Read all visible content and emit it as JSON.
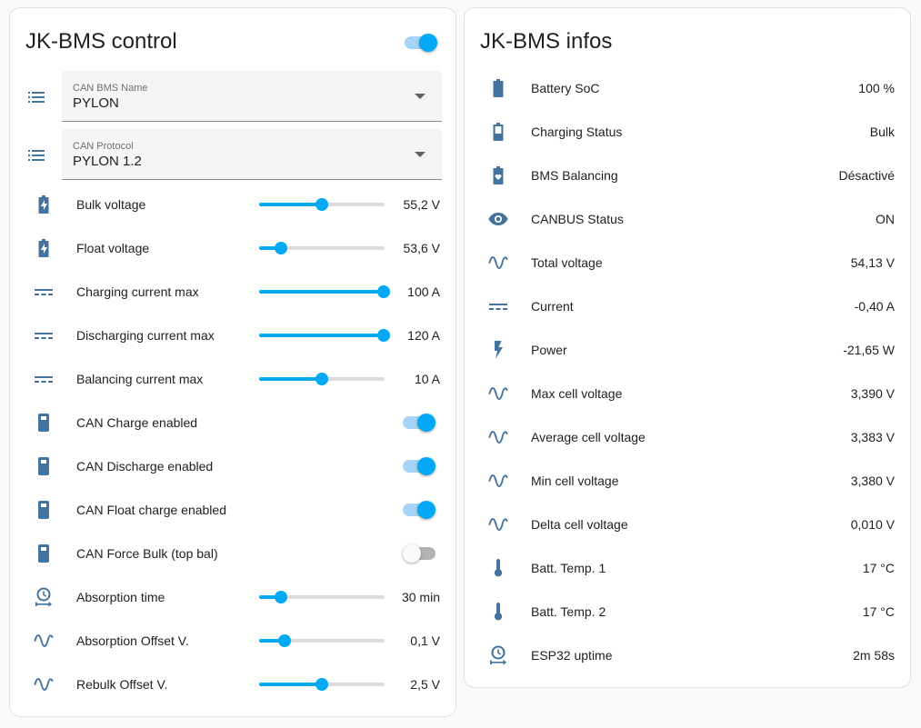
{
  "colors": {
    "accent": "#03a9f4",
    "icon": "#44739e"
  },
  "control": {
    "title": "JK-BMS control",
    "enabled": true,
    "selects": [
      {
        "label": "CAN BMS Name",
        "value": "PYLON",
        "icon": "list-icon"
      },
      {
        "label": "CAN Protocol",
        "value": "PYLON 1.2",
        "icon": "list-icon"
      }
    ],
    "rows": [
      {
        "label": "Bulk voltage",
        "value": "55,2 V",
        "icon": "battery-charging-icon",
        "level": 0.5
      },
      {
        "label": "Float voltage",
        "value": "53,6 V",
        "icon": "battery-charging-icon",
        "level": 0.17
      },
      {
        "label": "Charging current max",
        "value": "100 A",
        "icon": "current-dc-icon",
        "level": 1.0
      },
      {
        "label": "Discharging current max",
        "value": "120 A",
        "icon": "current-dc-icon",
        "level": 1.0
      },
      {
        "label": "Balancing current max",
        "value": "10 A",
        "icon": "current-dc-icon",
        "level": 0.5
      },
      {
        "label": "CAN Charge enabled",
        "on": true,
        "icon": "phone-device-icon"
      },
      {
        "label": "CAN Discharge enabled",
        "on": true,
        "icon": "phone-device-icon"
      },
      {
        "label": "CAN Float charge enabled",
        "on": true,
        "icon": "phone-device-icon"
      },
      {
        "label": "CAN Force Bulk (top bal)",
        "on": false,
        "icon": "phone-device-icon"
      },
      {
        "label": "Absorption time",
        "value": "30 min",
        "icon": "timer-arrow-icon",
        "level": 0.17
      },
      {
        "label": "Absorption Offset V.",
        "value": "0,1 V",
        "icon": "sine-wave-icon",
        "level": 0.2
      },
      {
        "label": "Rebulk Offset V.",
        "value": "2,5 V",
        "icon": "sine-wave-icon",
        "level": 0.5
      }
    ]
  },
  "infos": {
    "title": "JK-BMS infos",
    "rows": [
      {
        "label": "Battery SoC",
        "value": "100 %",
        "icon": "battery-full-icon"
      },
      {
        "label": "Charging Status",
        "value": "Bulk",
        "icon": "battery-icon"
      },
      {
        "label": "BMS Balancing",
        "value": "Désactivé",
        "icon": "battery-heart-icon"
      },
      {
        "label": "CANBUS Status",
        "value": "ON",
        "icon": "eye-icon"
      },
      {
        "label": "Total voltage",
        "value": "54,13 V",
        "icon": "sine-wave-icon"
      },
      {
        "label": "Current",
        "value": "-0,40 A",
        "icon": "current-dc-icon"
      },
      {
        "label": "Power",
        "value": "-21,65 W",
        "icon": "flash-icon"
      },
      {
        "label": "Max cell voltage",
        "value": "3,390 V",
        "icon": "sine-wave-icon"
      },
      {
        "label": "Average cell voltage",
        "value": "3,383 V",
        "icon": "sine-wave-icon"
      },
      {
        "label": "Min cell voltage",
        "value": "3,380 V",
        "icon": "sine-wave-icon"
      },
      {
        "label": "Delta cell voltage",
        "value": "0,010 V",
        "icon": "sine-wave-icon"
      },
      {
        "label": "Batt. Temp. 1",
        "value": "17 °C",
        "icon": "thermometer-icon"
      },
      {
        "label": "Batt. Temp. 2",
        "value": "17 °C",
        "icon": "thermometer-icon"
      },
      {
        "label": "ESP32 uptime",
        "value": "2m 58s",
        "icon": "timer-arrow-icon"
      }
    ]
  }
}
